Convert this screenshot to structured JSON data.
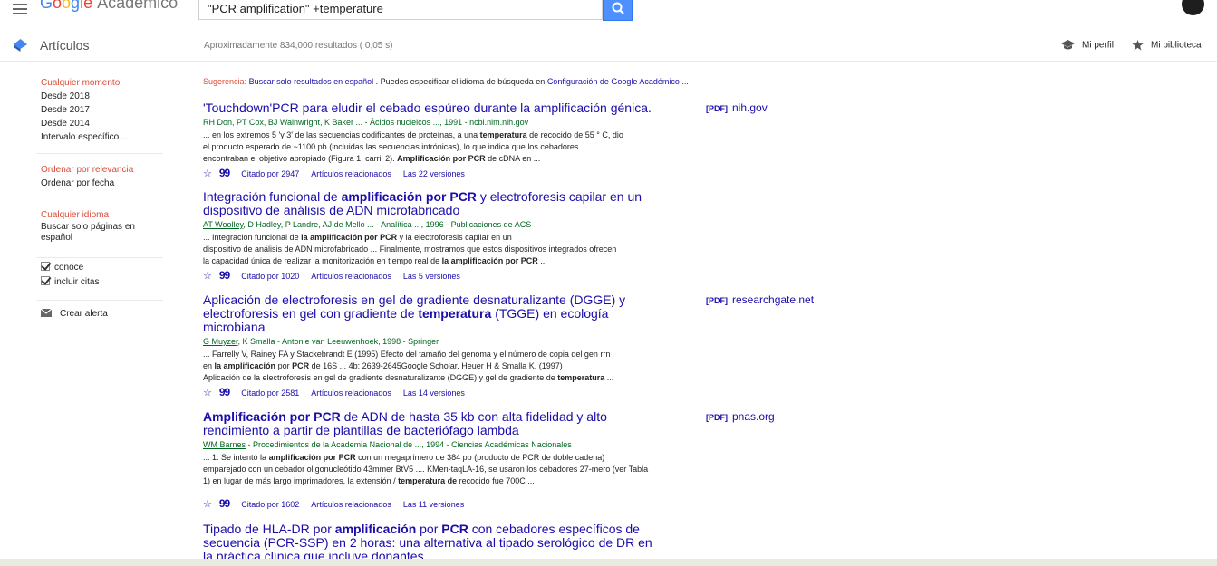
{
  "header": {
    "logo_text": "Google",
    "logo_sub": "Académico",
    "search_query": "\"PCR amplification\" +temperature"
  },
  "subheader": {
    "section": "Artículos",
    "results_count": "Aproximadamente 834,000 resultados ( 0,05 s)",
    "profile_label": "Mi perfil",
    "library_label": "Mi biblioteca"
  },
  "sidebar": {
    "time_header": "Cualquier momento",
    "time_items": [
      "Desde 2018",
      "Desde 2017",
      "Desde 2014",
      "Intervalo específico ..."
    ],
    "sort_header": "Ordenar por relevancia",
    "sort_items": [
      "Ordenar por fecha"
    ],
    "lang_header": "Cualquier idioma",
    "lang_item": "Buscar solo páginas en español",
    "check_patents": "conóce",
    "check_citations": "incluir citas",
    "alert_label": "Crear alerta"
  },
  "suggestion": {
    "label": "Sugerencia:",
    "link": "Buscar solo resultados en español",
    "middle": ". Puedes especificar el idioma de búsqueda en",
    "link2": "Configuración de Google Académico ..."
  },
  "results": [
    {
      "title": "'Touchdown'PCR para eludir el cebado espúreo durante la amplificación génica.",
      "authors": "RH Don, PT Cox, BJ Wainwright, K Baker ... - Ácidos nucleicos ..., 1991 - ncbi.nlm.nih.gov",
      "snippet1": "... en los extremos 5 'y 3' de las secuencias codificantes de proteínas, a una",
      "snippet1b": "temperatura",
      "snippet1c": "de recocido de 55 ° C, dio",
      "snippet2": "el producto esperado de ~1100 pb (incluidas las secuencias intrónicas), lo que indica que los cebadores",
      "snippet3": "encontraban el objetivo apropiado (Figura 1, carril 2).",
      "snippet3b": "Amplificación por PCR",
      "snippet3c": "de cDNA en ...",
      "cited": "Citado por 2947",
      "related": "Artículos relacionados",
      "versions": "Las 22 versiones",
      "pdf_tag": "[PDF]",
      "pdf_source": "nih.gov"
    },
    {
      "title_a": "Integración funcional de",
      "title_b": "amplificación por PCR",
      "title_c": "y electroforesis capilar en un",
      "title_d": "dispositivo de análisis de ADN microfabricado",
      "author_link": "AT Woolley",
      "authors": ", D Hadley, P Landre, AJ de Mello ... - Analítica ..., 1996 - Publicaciones de ACS",
      "snippet1": "... Integración funcional de",
      "snippet1b": "la amplificación por PCR",
      "snippet1c": "y la electroforesis capilar en un",
      "snippet2": "dispositivo de análisis de ADN microfabricado ... Finalmente, mostramos que estos dispositivos integrados ofrecen",
      "snippet3": "la capacidad única de realizar la monitorización en tiempo real de",
      "snippet3b": "la amplificación por PCR",
      "snippet3c": "...",
      "cited": "Citado por 1020",
      "related": "Artículos relacionados",
      "versions": "Las 5 versiones"
    },
    {
      "title_a": "Aplicación de electroforesis en gel de gradiente desnaturalizante (DGGE) y",
      "title_b": "electroforesis en gel con gradiente de",
      "title_c": "temperatura",
      "title_d": "(TGGE) en ecología",
      "title_e": "microbiana",
      "author_link": "G Muyzer",
      "authors": ", K Smalla - Antonie van Leeuwenhoek, 1998 - Springer",
      "snippet1": "... Farrelly V, Rainey FA y Stackebrandt E (1995) Efecto del tamaño del genoma y el número de copia del gen rrn",
      "snippet2a": "en",
      "snippet2b": "la amplificación",
      "snippet2c": "por",
      "snippet2d": "PCR",
      "snippet2e": "de 16S ... 4b: 2639-2645Google Scholar. Heuer H & Smalla K. (1997)",
      "snippet3": "Aplicación de la electroforesis en gel de gradiente desnaturalizante (DGGE) y gel de gradiente de",
      "snippet3b": "temperatura",
      "snippet3c": "...",
      "cited": "Citado por 2581",
      "related": "Artículos relacionados",
      "versions": "Las 14 versiones",
      "pdf_tag": "[PDF]",
      "pdf_source": "researchgate.net"
    },
    {
      "title_a": "Amplificación por PCR",
      "title_b": "de ADN de hasta 35 kb con alta fidelidad y alto",
      "title_c": "rendimiento a partir de plantillas de bacteriófago lambda",
      "author_link": "WM Barnes",
      "authors": "- Procedimientos de la Academia Nacional de ..., 1994 - Ciencias Académicas Nacionales",
      "snippet1a": "... 1. Se intentó la",
      "snippet1b": "amplificación por PCR",
      "snippet1c": "con un megaprímero de 384 pb (producto de PCR de doble cadena)",
      "snippet2": "emparejado con un cebador oligonucleótido 43mmer BtV5 .... KMen-taqLA-16, se usaron los cebadores 27-mero (ver Tabla",
      "snippet3a": "1) en lugar de más largo imprimadores, la extensión /",
      "snippet3b": "temperatura de",
      "snippet3c": "recocido fue 700C ...",
      "cited": "Citado por 1602",
      "related": "Artículos relacionados",
      "versions": "Las 11 versiones",
      "pdf_tag": "[PDF]",
      "pdf_source": "pnas.org"
    },
    {
      "title_a": "Tipado de HLA-DR por",
      "title_b": "amplificación",
      "title_c": "por",
      "title_d": "PCR",
      "title_e": "con cebadores específicos de",
      "title_f": "secuencia (PCR-SSP) en 2 horas: una alternativa al tipado serológico de DR en",
      "title_g": "la práctica clínica que incluye donantes"
    }
  ]
}
